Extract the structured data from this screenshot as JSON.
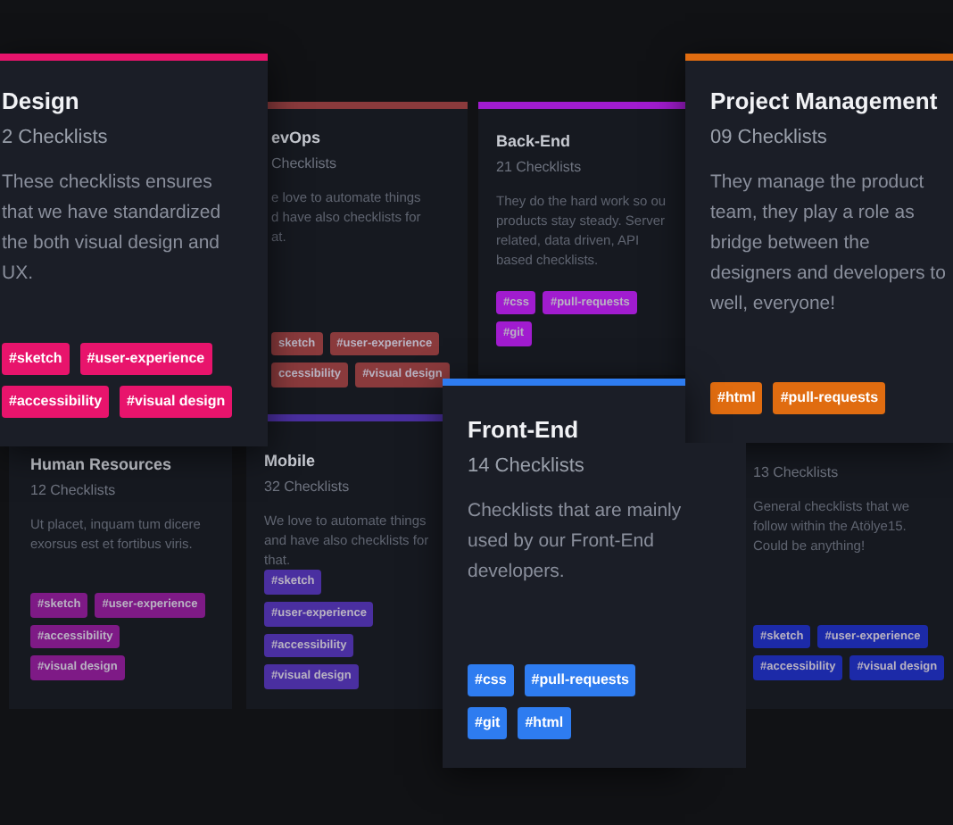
{
  "cards": [
    {
      "kind": "back",
      "title": "evOps",
      "count": "Checklists",
      "description": [
        "e love to automate things",
        "d have also checklists for",
        "at."
      ],
      "accent_bar": true,
      "color": "#8a3a3c",
      "tags": [
        "sketch",
        "#user-experience",
        "ccessibility",
        "#visual design"
      ]
    },
    {
      "kind": "back",
      "title": "Back-End",
      "count": "21 Checklists",
      "description": [
        "They do the hard work so ou",
        "products stay steady. Server",
        "related, data driven, API",
        "based checklists."
      ],
      "accent_bar": true,
      "color": "#a11ccf",
      "tags": [
        "#css",
        "#pull-requests",
        "#git"
      ]
    },
    {
      "kind": "back",
      "title": "Human Resources",
      "count": "12 Checklists",
      "description": [
        "Ut placet, inquam tum dicere",
        "exorsus est et fortibus viris."
      ],
      "accent_bar": false,
      "color": "#7e1a86",
      "tags": [
        "#sketch",
        "#user-experience",
        "#accessibility",
        "#visual design"
      ]
    },
    {
      "kind": "back",
      "title": "Mobile",
      "count": "32 Checklists",
      "description": [
        "We love to automate things",
        "and have also checklists for",
        "that."
      ],
      "accent_bar": true,
      "color": "#4a2fa0",
      "tags": [
        "#sketch",
        "#user-experience",
        "#accessibility",
        "#visual design"
      ]
    },
    {
      "kind": "back",
      "count": "13 Checklists",
      "description": [
        "General checklists that we",
        "follow within the Atölye15.",
        "Could be anything!"
      ],
      "accent_bar": false,
      "color": "#1c2aa8",
      "tags": [
        "#sketch",
        "#user-experience",
        "#accessibility",
        "#visual design"
      ]
    },
    {
      "kind": "front",
      "title": "Design",
      "count": "2 Checklists",
      "description": [
        "These checklists ensures",
        "that we have standardized",
        "the both visual design and",
        "UX."
      ],
      "accent_bar": true,
      "color": "#e8146c",
      "tags": [
        "#sketch",
        "#user-experience",
        "#accessibility",
        "#visual design"
      ]
    },
    {
      "kind": "front",
      "title": "Project Management",
      "count": "09 Checklists",
      "description": [
        "They manage the product",
        "team, they play a role as",
        "bridge between the",
        "designers and developers to",
        "well, everyone!"
      ],
      "accent_bar": true,
      "color": "#e06c10",
      "tags": [
        "#html",
        "#pull-requests"
      ]
    },
    {
      "kind": "front",
      "title": "Front-End",
      "count": "14 Checklists",
      "description": [
        "Checklists that are mainly",
        "used by our Front-End",
        "developers."
      ],
      "accent_bar": true,
      "color": "#2e7cf0",
      "tags": [
        "#css",
        "#pull-requests",
        "#git",
        "#html"
      ]
    }
  ]
}
